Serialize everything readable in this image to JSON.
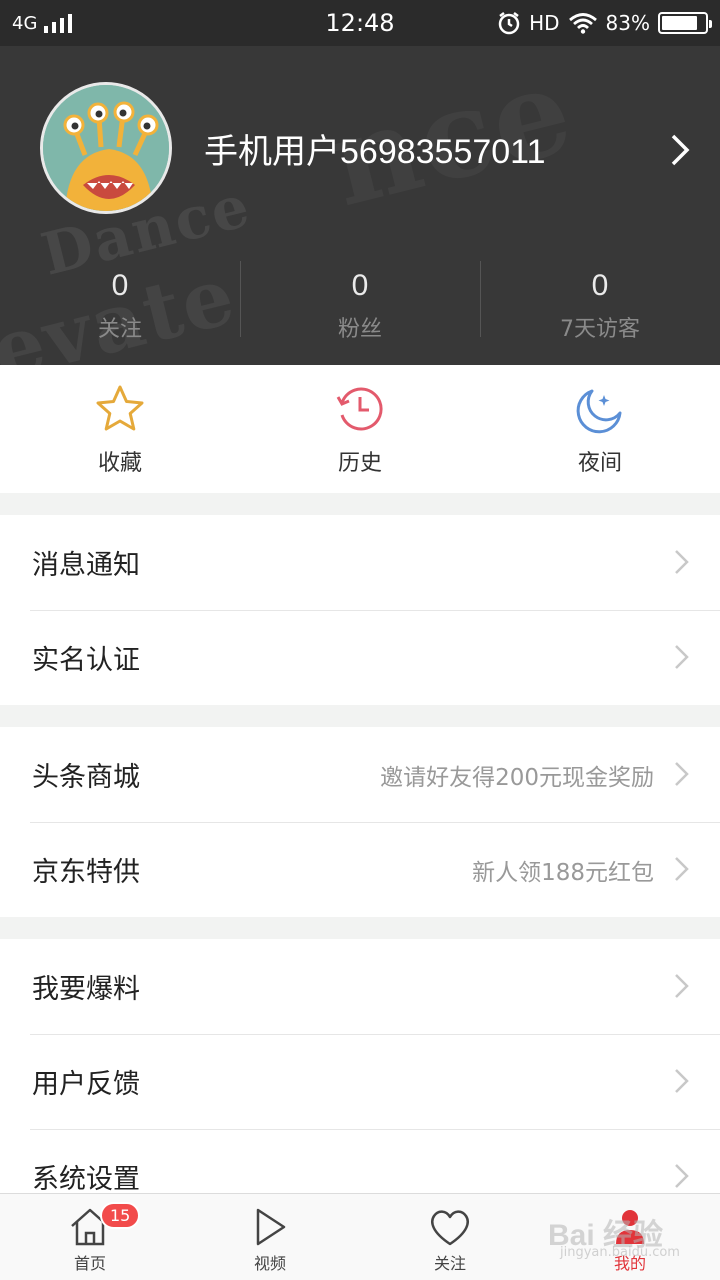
{
  "status_bar": {
    "network": "4G",
    "time": "12:48",
    "hd": "HD",
    "battery": "83%",
    "battery_level": 0.83
  },
  "profile": {
    "username": "手机用户56983557011",
    "stats": [
      {
        "value": "0",
        "label": "关注"
      },
      {
        "value": "0",
        "label": "粉丝"
      },
      {
        "value": "0",
        "label": "7天访客"
      }
    ]
  },
  "quick_actions": [
    {
      "label": "收藏",
      "icon": "star-icon",
      "color": "#e5a93a"
    },
    {
      "label": "历史",
      "icon": "history-icon",
      "color": "#e35a6c"
    },
    {
      "label": "夜间",
      "icon": "moon-icon",
      "color": "#5b8fd6"
    }
  ],
  "menu_groups": [
    [
      {
        "label": "消息通知",
        "hint": ""
      },
      {
        "label": "实名认证",
        "hint": ""
      }
    ],
    [
      {
        "label": "头条商城",
        "hint": "邀请好友得200元现金奖励"
      },
      {
        "label": "京东特供",
        "hint": "新人领188元红包"
      }
    ],
    [
      {
        "label": "我要爆料",
        "hint": ""
      },
      {
        "label": "用户反馈",
        "hint": ""
      },
      {
        "label": "系统设置",
        "hint": ""
      }
    ]
  ],
  "tab_bar": {
    "tabs": [
      {
        "label": "首页",
        "icon": "home-icon"
      },
      {
        "label": "视频",
        "icon": "play-icon"
      },
      {
        "label": "关注",
        "icon": "heart-icon"
      },
      {
        "label": "我的",
        "icon": "user-icon",
        "active": true
      }
    ],
    "home_badge": "15"
  },
  "watermark": {
    "text": "Bai 经验",
    "url": "jingyan.baidu.com"
  },
  "colors": {
    "header_bg": "#383838",
    "accent_red": "#e1343a",
    "badge_red": "#f24b4b"
  }
}
